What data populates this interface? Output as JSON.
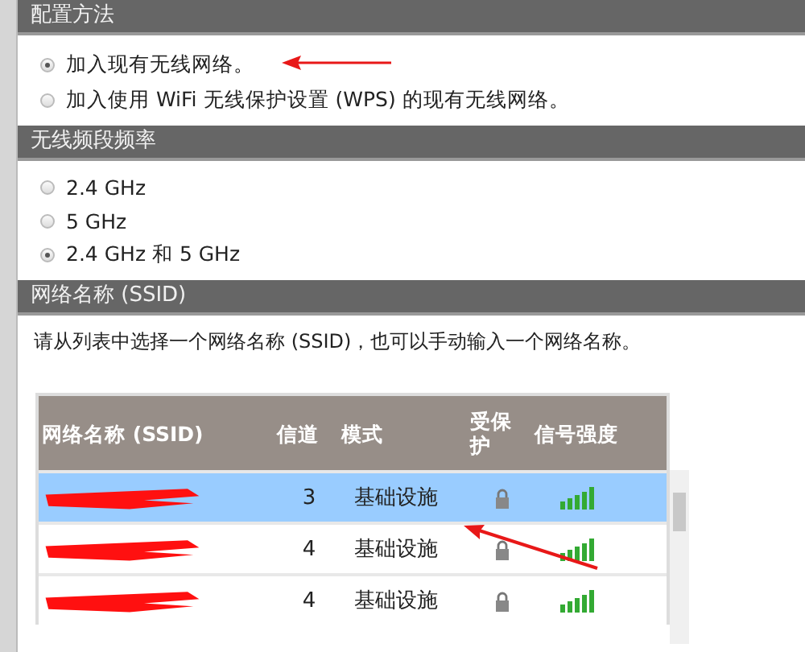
{
  "sections": [
    {
      "title": "配置方法",
      "options": [
        {
          "label": "加入现有无线网络。",
          "selected": true
        },
        {
          "label": "加入使用 WiFi 无线保护设置 (WPS) 的现有无线网络。",
          "selected": false
        }
      ]
    },
    {
      "title": "无线频段频率",
      "options": [
        {
          "label": "2.4 GHz",
          "selected": false
        },
        {
          "label": "5 GHz",
          "selected": false
        },
        {
          "label": "2.4 GHz 和 5 GHz",
          "selected": true
        }
      ]
    }
  ],
  "ssid_section": {
    "title": "网络名称 (SSID)",
    "description": "请从列表中选择一个网络名称 (SSID)，也可以手动输入一个网络名称。",
    "table": {
      "columns": [
        "网络名称 (SSID)",
        "信道",
        "模式",
        "受保护",
        "信号强度"
      ],
      "rows": [
        {
          "channel": "3",
          "mode": "基础设施",
          "protected": true,
          "selected": true
        },
        {
          "channel": "4",
          "mode": "基础设施",
          "protected": true,
          "selected": false
        },
        {
          "channel": "4",
          "mode": "基础设施",
          "protected": true,
          "selected": false
        }
      ]
    }
  }
}
